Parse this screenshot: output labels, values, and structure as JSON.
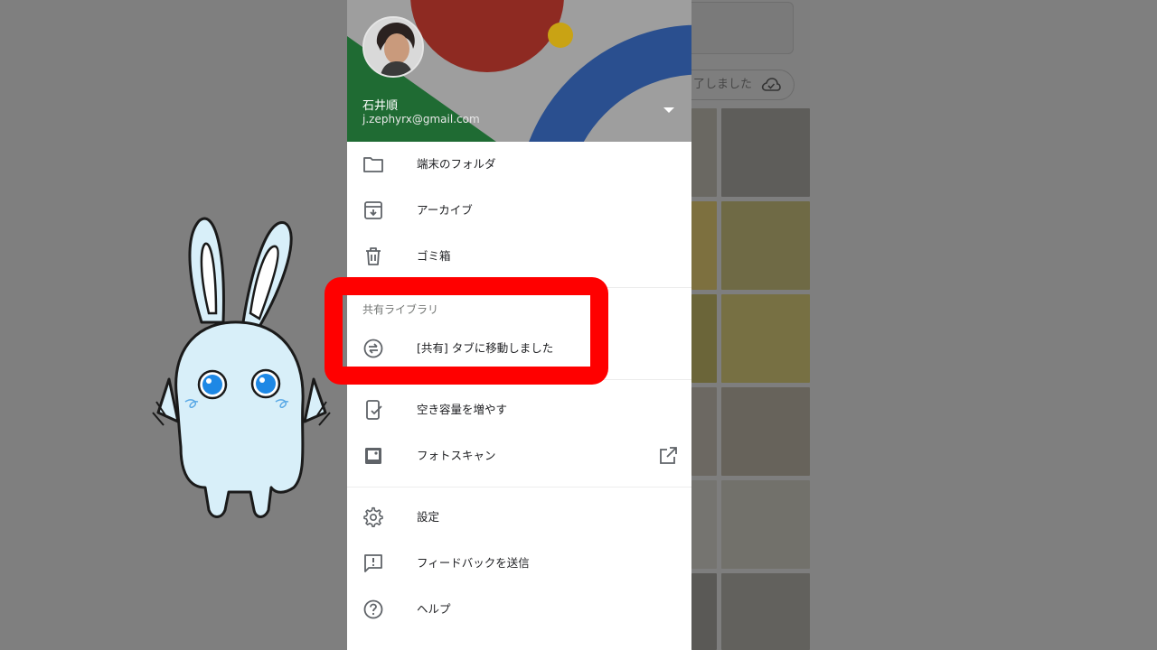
{
  "account": {
    "name": "石井順",
    "email": "j.zephyrx@gmail.com"
  },
  "menu": {
    "device_folders": "端末のフォルダ",
    "archive": "アーカイブ",
    "trash": "ゴミ箱",
    "shared_section_title": "共有ライブラリ",
    "shared_moved": "[共有] タブに移動しました",
    "free_up_space": "空き容量を増やす",
    "photoscan": "フォトスキャン",
    "settings": "設定",
    "send_feedback": "フィードバックを送信",
    "help": "ヘルプ"
  },
  "background_app": {
    "status_chip": "了しました"
  },
  "colors": {
    "highlight": "#ff0000",
    "header_red": "#8e2a22",
    "header_blue": "#2a4f8f",
    "header_green": "#1f6b33",
    "header_yellow": "#c9a314",
    "icon_gray": "#5f6368"
  },
  "icons": [
    "folder-icon",
    "archive-icon",
    "trash-icon",
    "shared-sync-icon",
    "phone-check-icon",
    "photoscan-icon",
    "open-in-new-icon",
    "gear-icon",
    "feedback-icon",
    "help-icon",
    "chevron-down-icon",
    "cloud-done-icon"
  ]
}
